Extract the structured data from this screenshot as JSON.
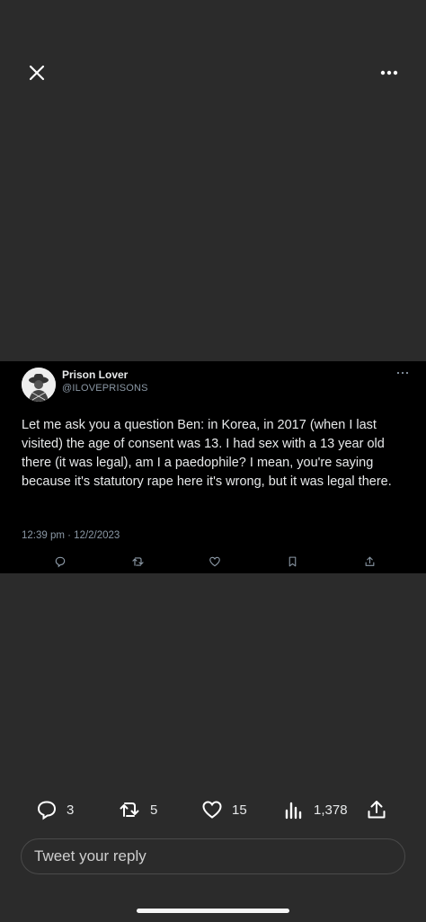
{
  "header": {
    "close_icon": "close-icon",
    "more_icon": "more-horizontal-icon"
  },
  "tweet": {
    "display_name": "Prison Lover",
    "handle": "@ILOVEPRISONS",
    "text": "Let me ask you a question Ben: in Korea, in 2017 (when I last visited) the age of consent was 13. I had sex with a 13 year old there (it was legal), am I a paedophile? I mean, you're saying because it's statutory rape here it's wrong, but it was legal there.",
    "timestamp": "12:39 pm · 12/2/2023",
    "actions": [
      "reply-icon",
      "retweet-icon",
      "like-icon",
      "bookmark-icon",
      "share-icon"
    ]
  },
  "stats": {
    "replies": "3",
    "retweets": "5",
    "likes": "15",
    "views": "1,378"
  },
  "reply": {
    "placeholder": "Tweet your reply"
  },
  "colors": {
    "background": "#2b2b2b",
    "tweet_background": "#000000",
    "muted_text": "#8b98a5",
    "primary_text": "#e7e9ea"
  }
}
